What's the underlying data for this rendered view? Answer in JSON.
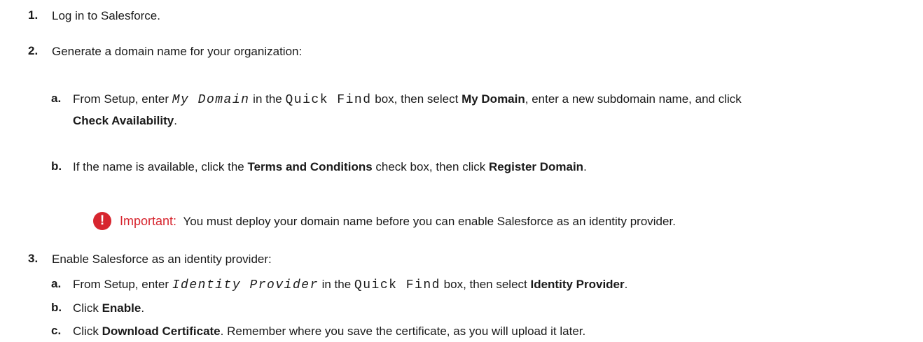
{
  "steps": [
    {
      "number": "1.",
      "text": "Log in to Salesforce."
    },
    {
      "number": "2.",
      "text": "Generate a domain name for your organization:",
      "substeps": [
        {
          "letter": "a.",
          "t1": "From Setup, enter ",
          "code1": "My Domain",
          "t2": " in the ",
          "code2": "Quick Find",
          "t3": " box, then select ",
          "b1": "My Domain",
          "t4": ", enter a new subdomain name, and click",
          "b2": "Check Availability",
          "t5": "."
        },
        {
          "letter": "b.",
          "t1": "If the name is available, click the ",
          "b1": "Terms and Conditions",
          "t2": " check box, then click ",
          "b2": "Register Domain",
          "t3": "."
        }
      ]
    },
    {
      "number": "3.",
      "text": "Enable Salesforce as an identity provider:",
      "substeps": [
        {
          "letter": "a.",
          "t1": "From Setup, enter ",
          "code1": "Identity Provider",
          "t2": " in the ",
          "code2": "Quick Find",
          "t3": " box, then select ",
          "b1": "Identity Provider",
          "t4": "."
        },
        {
          "letter": "b.",
          "t1": "Click ",
          "b1": "Enable",
          "t2": "."
        },
        {
          "letter": "c.",
          "t1": "Click ",
          "b1": "Download Certificate",
          "t2": ". Remember where you save the certificate, as you will upload it later."
        }
      ]
    }
  ],
  "note": {
    "icon": "!",
    "label": "Important:",
    "text": "You must deploy your domain name before you can enable Salesforce as an identity provider."
  },
  "colors": {
    "accent": "#d7262f"
  }
}
